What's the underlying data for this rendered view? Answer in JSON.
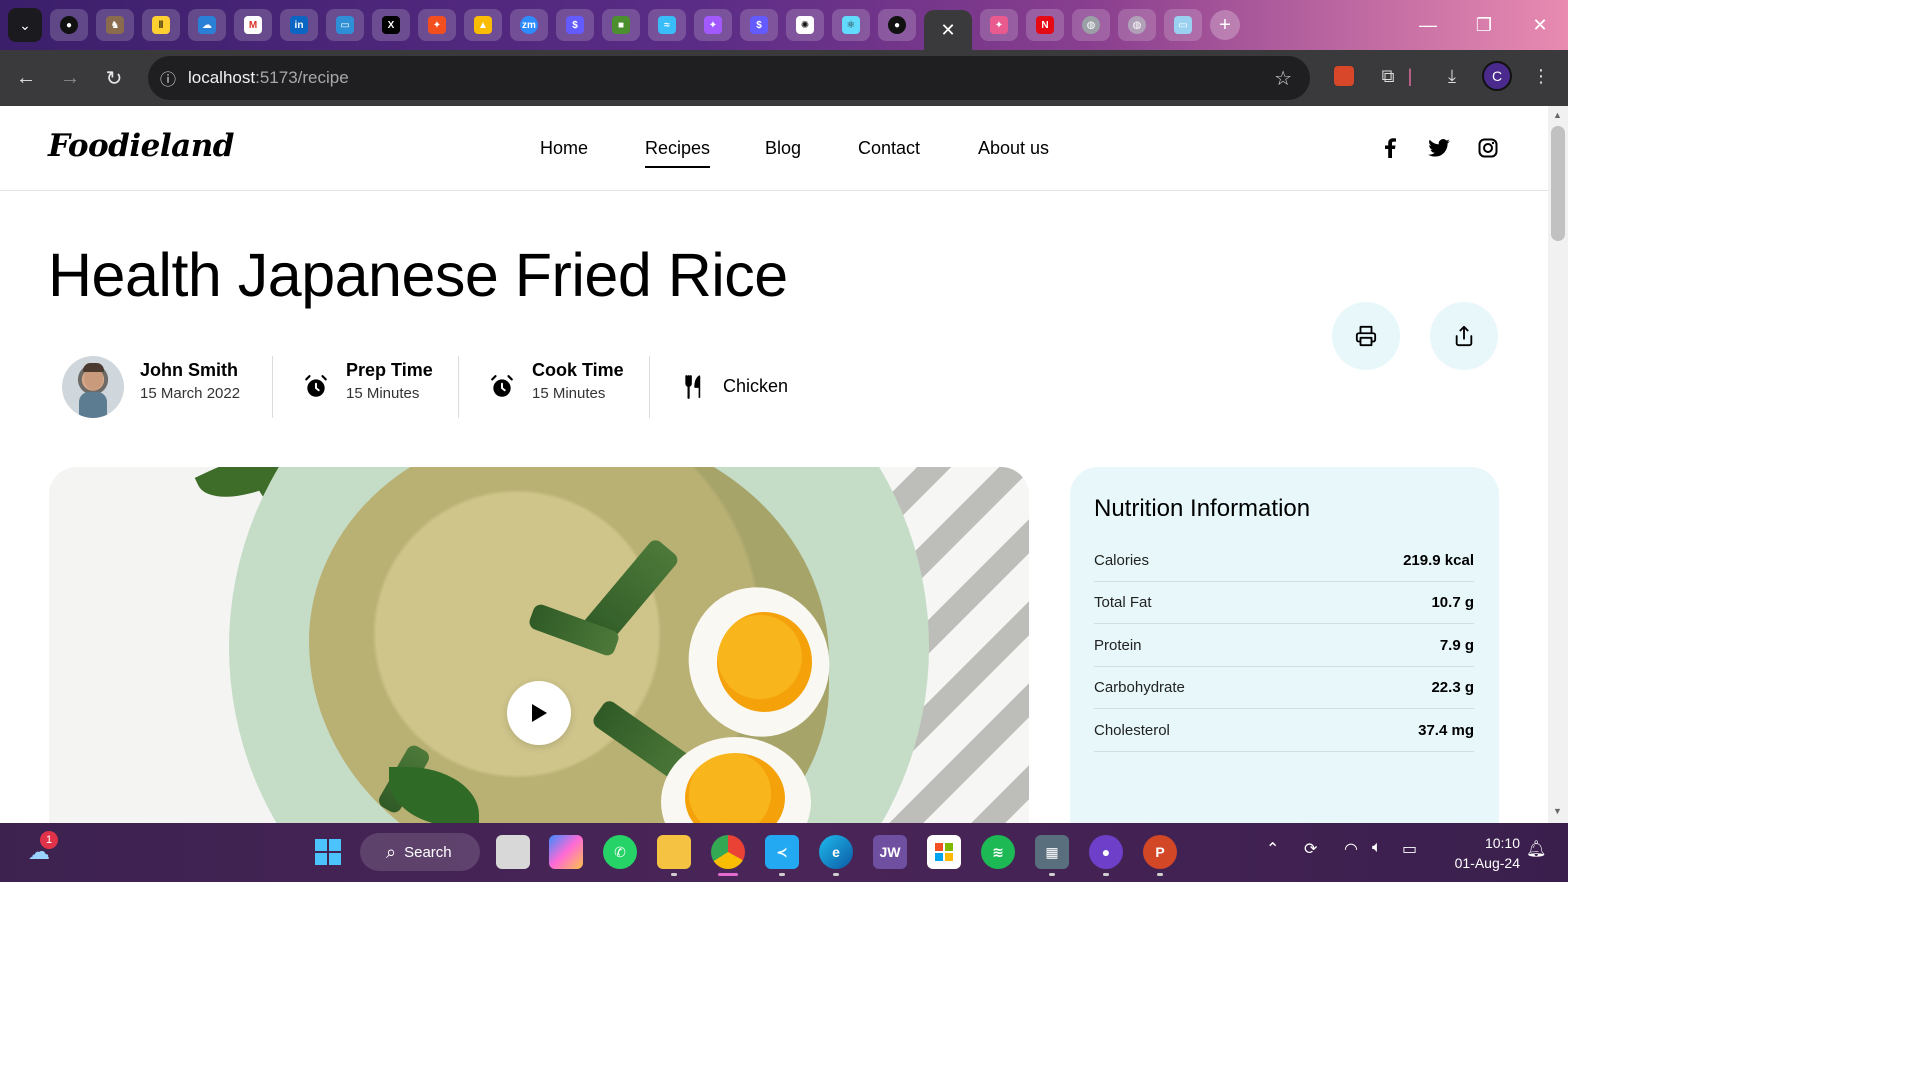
{
  "browser": {
    "active_tab_close": "✕",
    "new_tab": "+",
    "url_host": "localhost",
    "url_path": ":5173/recipe",
    "profile_initial": "C",
    "tab_favicons": [
      "github",
      "deno",
      "miro",
      "edge-cloud",
      "gmail",
      "linkedin",
      "snip",
      "x",
      "figma",
      "google-ads",
      "zoom",
      "stripe",
      "green-square",
      "tailwind",
      "figma",
      "stripe",
      "openai",
      "react",
      "github"
    ]
  },
  "site": {
    "logo": "Foodieland",
    "nav": [
      "Home",
      "Recipes",
      "Blog",
      "Contact",
      "About us"
    ],
    "nav_active": "Recipes",
    "social": [
      "facebook-icon",
      "twitter-icon",
      "instagram-icon"
    ]
  },
  "recipe": {
    "title": "Health Japanese Fried Rice",
    "author": "John Smith",
    "date": "15 March 2022",
    "prep_label": "Prep Time",
    "prep_value": "15 Minutes",
    "cook_label": "Cook Time",
    "cook_value": "15 Minutes",
    "category": "Chicken"
  },
  "nutrition": {
    "title": "Nutrition Information",
    "rows": [
      {
        "label": "Calories",
        "value": "219.9 kcal"
      },
      {
        "label": "Total Fat",
        "value": "10.7 g"
      },
      {
        "label": "Protein",
        "value": "7.9 g"
      },
      {
        "label": "Carbohydrate",
        "value": "22.3 g"
      },
      {
        "label": "Cholesterol",
        "value": "37.4 mg"
      }
    ]
  },
  "taskbar": {
    "search_label": "Search",
    "weather_badge": "1",
    "time": "10:10",
    "date": "01-Aug-24"
  }
}
